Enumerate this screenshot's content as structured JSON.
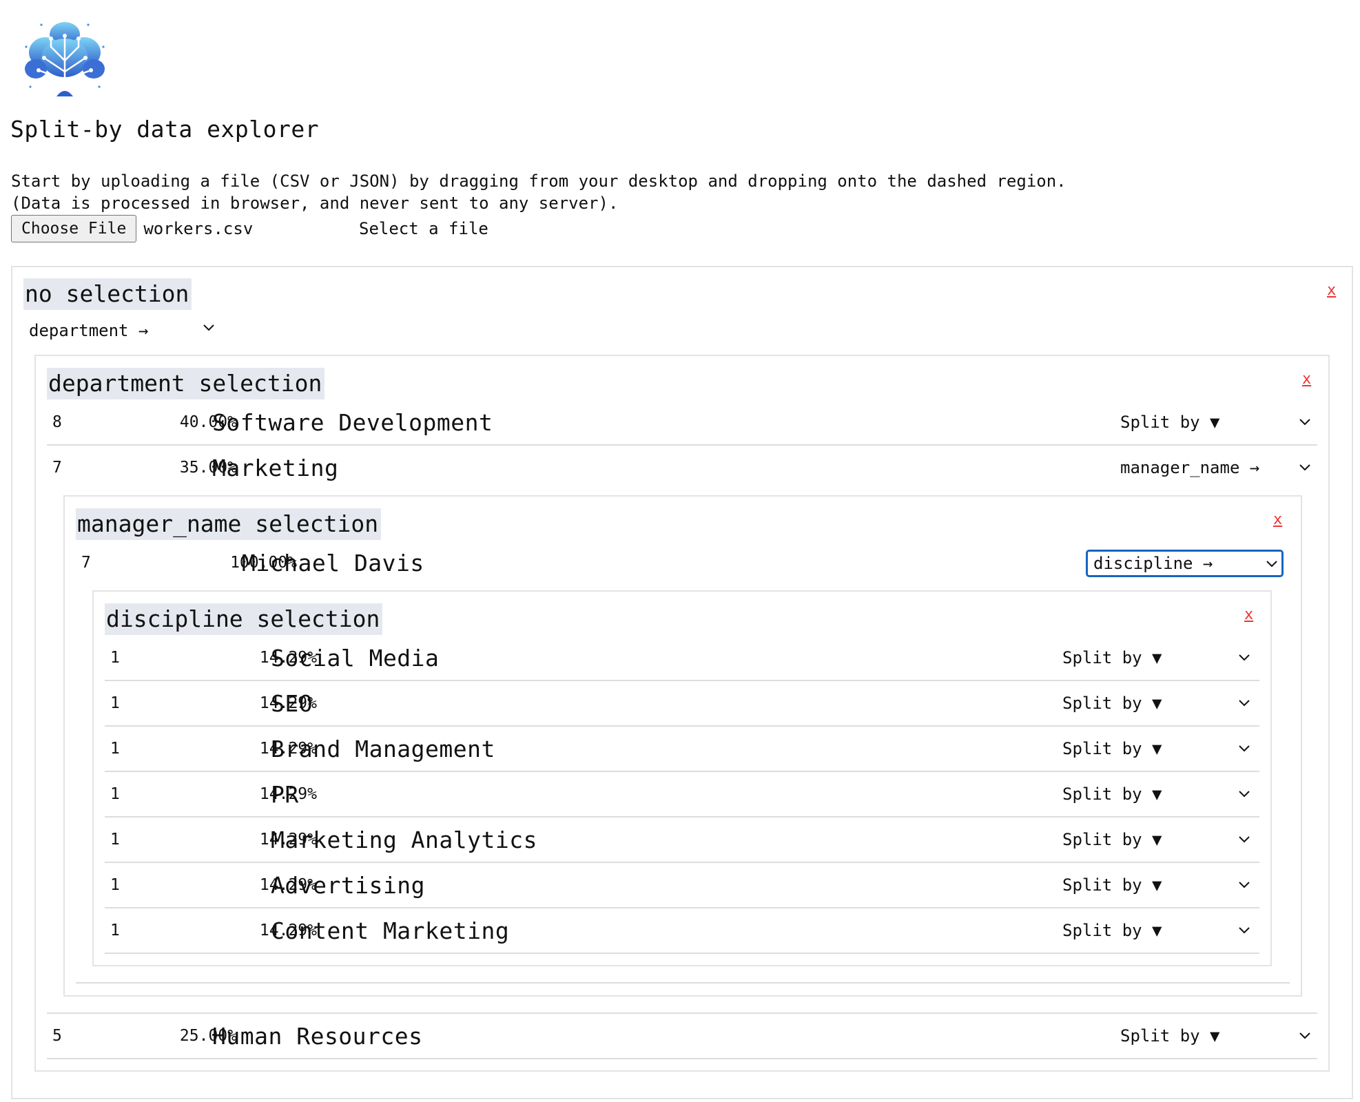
{
  "app": {
    "title": "Split-by data explorer",
    "intro_line1": "Start by uploading a file (CSV or JSON) by dragging from your desktop and dropping onto the dashed region.",
    "intro_line2": "(Data is processed in browser, and never sent to any server).",
    "choose_file_label": "Choose File",
    "file_name": "workers.csv",
    "select_file_text": "Select a file"
  },
  "root": {
    "title": "no selection",
    "close_label": "x",
    "split_select": "department →"
  },
  "department": {
    "title": "department selection",
    "close_label": "x",
    "rows": [
      {
        "count": "8",
        "pct": "40.00%",
        "label": "Software Development",
        "split": "Split by ▼"
      },
      {
        "count": "7",
        "pct": "35.00%",
        "label": "Marketing",
        "split": "manager_name →"
      },
      {
        "count": "5",
        "pct": "25.00%",
        "label": "Human Resources",
        "split": "Split by ▼"
      }
    ]
  },
  "manager": {
    "title": "manager_name selection",
    "close_label": "x",
    "rows": [
      {
        "count": "7",
        "pct": "100.00%",
        "label": "Michael Davis",
        "split": "discipline →"
      }
    ]
  },
  "discipline": {
    "title": "discipline selection",
    "close_label": "x",
    "rows": [
      {
        "count": "1",
        "pct": "14.29%",
        "label": "Social Media",
        "split": "Split by ▼"
      },
      {
        "count": "1",
        "pct": "14.29%",
        "label": "SEO",
        "split": "Split by ▼"
      },
      {
        "count": "1",
        "pct": "14.29%",
        "label": "Brand Management",
        "split": "Split by ▼"
      },
      {
        "count": "1",
        "pct": "14.29%",
        "label": "PR",
        "split": "Split by ▼"
      },
      {
        "count": "1",
        "pct": "14.29%",
        "label": "Marketing Analytics",
        "split": "Split by ▼"
      },
      {
        "count": "1",
        "pct": "14.29%",
        "label": "Advertising",
        "split": "Split by ▼"
      },
      {
        "count": "1",
        "pct": "14.29%",
        "label": "Content Marketing",
        "split": "Split by ▼"
      }
    ]
  },
  "colors": {
    "accent_focus": "#1565c0",
    "close": "#e33333",
    "title_bg": "#e5e9ef"
  }
}
